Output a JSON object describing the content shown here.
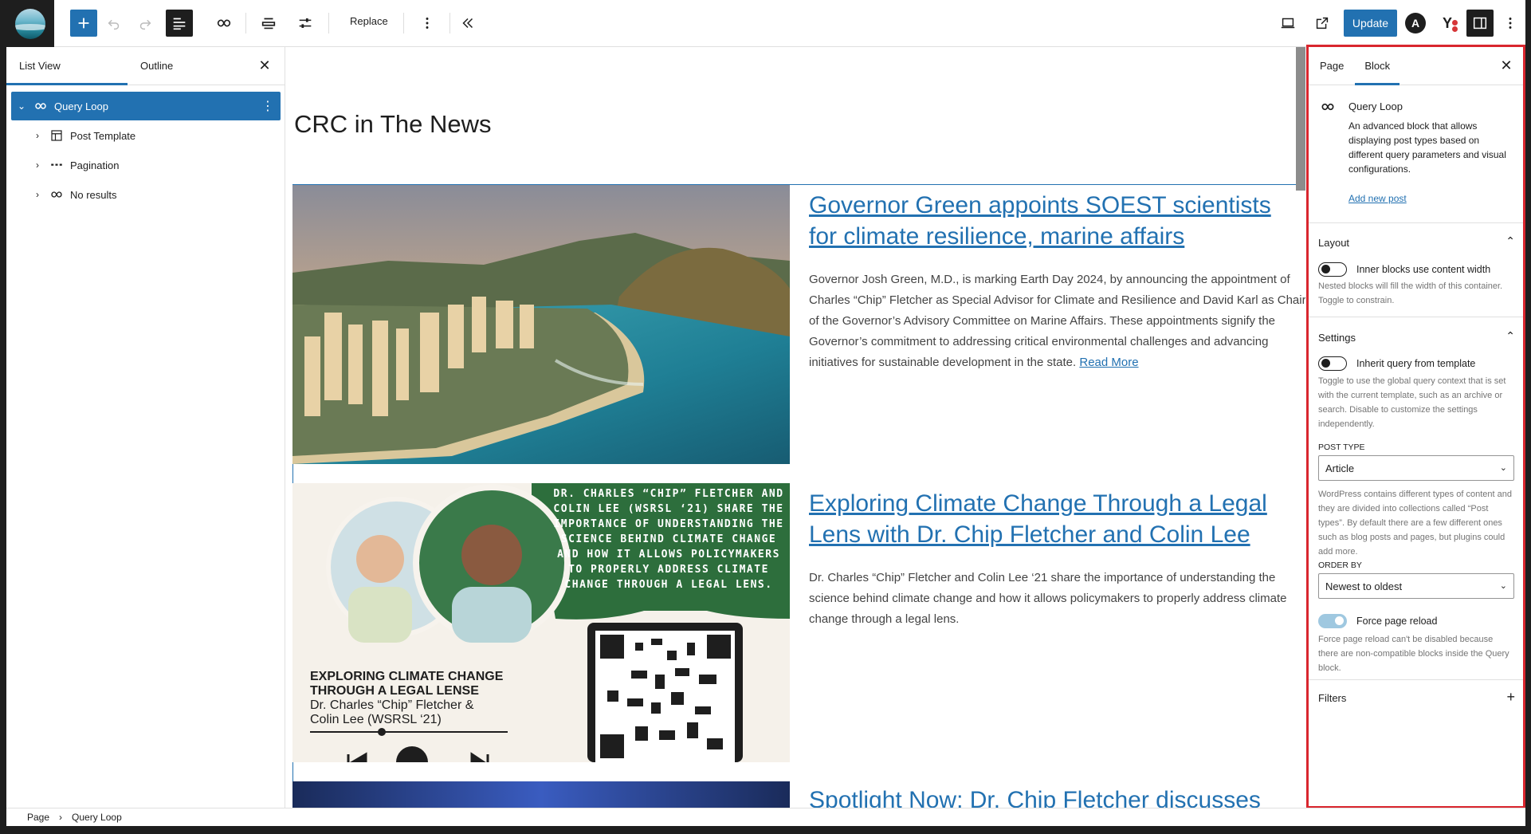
{
  "toolbar": {
    "replace_label": "Replace",
    "update_label": "Update",
    "avatar_letter": "A",
    "yoast_letter": "Y"
  },
  "left_panel": {
    "tabs": [
      "List View",
      "Outline"
    ],
    "tree": [
      {
        "label": "Query Loop",
        "icon": "loop-icon",
        "selected": true
      },
      {
        "label": "Post Template",
        "icon": "layout-icon"
      },
      {
        "label": "Pagination",
        "icon": "pagination-icon"
      },
      {
        "label": "No results",
        "icon": "loop-icon"
      }
    ]
  },
  "breadcrumb": [
    "Page",
    "Query Loop"
  ],
  "canvas": {
    "heading": "CRC in The News",
    "posts": [
      {
        "title": "Governor Green appoints SOEST scientists for climate resilience, marine affairs",
        "excerpt": "Governor Josh Green, M.D., is marking Earth Day 2024, by announcing the appointment of Charles “Chip” Fletcher as Special Advisor for Climate and Resilience and David Karl as Chair of the Governor’s Advisory Committee on Marine Affairs. These appointments signify the Governor’s commitment to addressing critical environmental challenges and advancing initiatives for sustainable development in the state.",
        "read_more": "Read More"
      },
      {
        "title": "Exploring Climate Change Through a Legal Lens with Dr. Chip Fletcher and Colin Lee",
        "excerpt": "Dr. Charles “Chip” Fletcher and Colin Lee ‘21 share the importance of understanding the science behind climate change and how it allows policymakers to properly address climate change through a legal lens.",
        "image_banner": "DR. CHARLES “CHIP” FLETCHER AND COLIN LEE (WSRSL ‘21) SHARE THE IMPORTANCE OF UNDERSTANDING THE SCIENCE BEHIND CLIMATE CHANGE AND HOW IT ALLOWS POLICYMAKERS TO PROPERLY ADDRESS CLIMATE CHANGE THROUGH A LEGAL LENS.",
        "image_title": "EXPLORING CLIMATE CHANGE THROUGH A LEGAL LENSE",
        "image_sub": "Dr. Charles “Chip” Fletcher & Colin Lee (WSRSL ‘21)"
      },
      {
        "title": "Spotlight Now: Dr. Chip Fletcher discusses"
      }
    ]
  },
  "right_panel": {
    "tabs": [
      "Page",
      "Block"
    ],
    "block_name": "Query Loop",
    "block_desc": "An advanced block that allows displaying post types based on different query parameters and visual configurations.",
    "add_new_post": "Add new post",
    "layout": {
      "title": "Layout",
      "toggle_label": "Inner blocks use content width",
      "help": "Nested blocks will fill the width of this container. Toggle to constrain."
    },
    "settings": {
      "title": "Settings",
      "inherit_label": "Inherit query from template",
      "inherit_help": "Toggle to use the global query context that is set with the current template, such as an archive or search. Disable to customize the settings independently.",
      "post_type_label": "POST TYPE",
      "post_type_value": "Article",
      "post_type_help": "WordPress contains different types of content and they are divided into collections called “Post types”. By default there are a few different ones such as blog posts and pages, but plugins could add more.",
      "order_by_label": "ORDER BY",
      "order_by_value": "Newest to oldest",
      "reload_label": "Force page reload",
      "reload_help": "Force page reload can't be disabled because there are non-compatible blocks inside the Query block."
    },
    "filters_title": "Filters"
  },
  "colors": {
    "accent": "#2271b1",
    "highlight_border": "#d9262e"
  }
}
